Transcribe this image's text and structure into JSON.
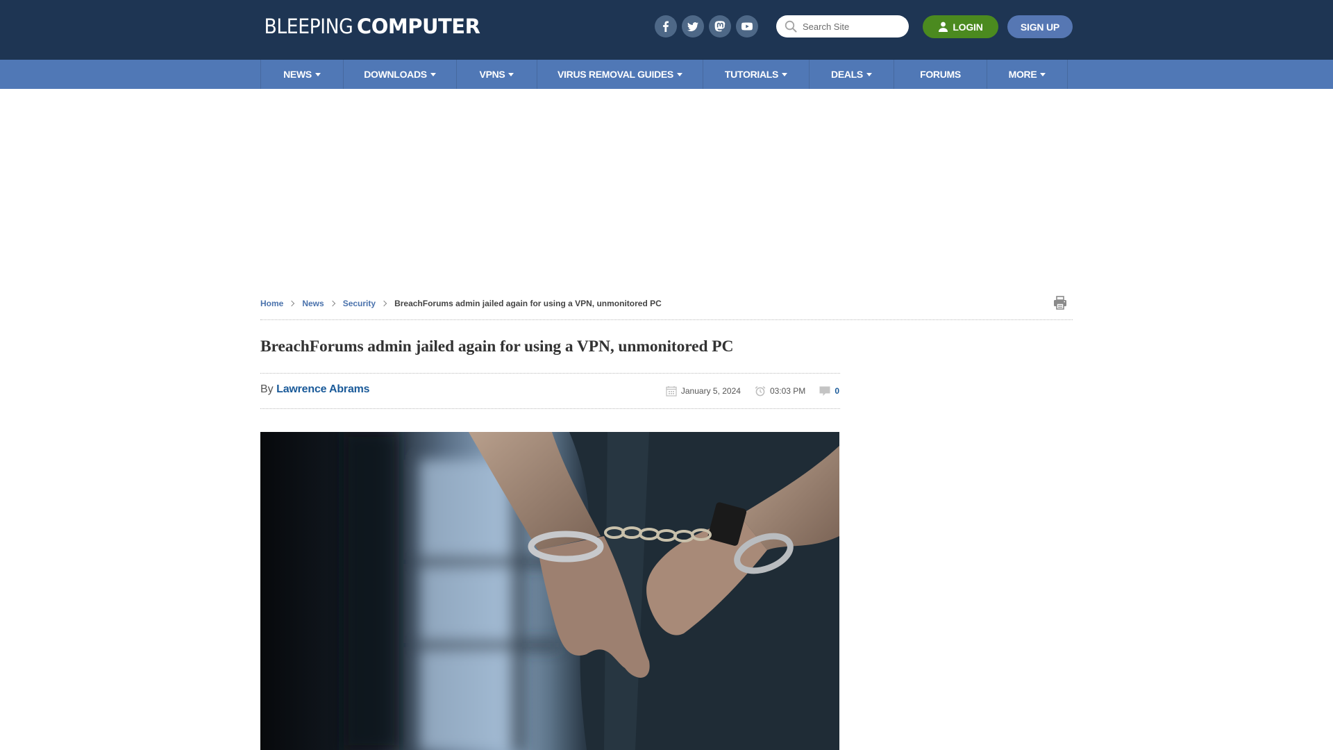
{
  "header": {
    "logo_light": "BLEEPING",
    "logo_bold": "COMPUTER",
    "socials": [
      {
        "name": "facebook",
        "icon": "facebook-icon"
      },
      {
        "name": "twitter",
        "icon": "twitter-icon"
      },
      {
        "name": "mastodon",
        "icon": "mastodon-icon"
      },
      {
        "name": "youtube",
        "icon": "youtube-icon"
      }
    ],
    "search_placeholder": "Search Site",
    "login_label": "LOGIN",
    "signup_label": "SIGN UP",
    "colors": {
      "topbar": "#1e3553",
      "nav": "#5078b6",
      "login": "#4b8a1f",
      "signup": "#5677b3"
    }
  },
  "nav": {
    "items": [
      {
        "label": "NEWS",
        "dropdown": true
      },
      {
        "label": "DOWNLOADS",
        "dropdown": true
      },
      {
        "label": "VPNS",
        "dropdown": true
      },
      {
        "label": "VIRUS REMOVAL GUIDES",
        "dropdown": true
      },
      {
        "label": "TUTORIALS",
        "dropdown": true
      },
      {
        "label": "DEALS",
        "dropdown": true
      },
      {
        "label": "FORUMS",
        "dropdown": false
      },
      {
        "label": "MORE",
        "dropdown": true
      }
    ]
  },
  "breadcrumb": {
    "items": [
      "Home",
      "News",
      "Security"
    ],
    "current": "BreachForums admin jailed again for using a VPN, unmonitored PC"
  },
  "article": {
    "title": "BreachForums admin jailed again for using a VPN, unmonitored PC",
    "by_prefix": "By",
    "author": "Lawrence Abrams",
    "date": "January 5, 2024",
    "time": "03:03 PM",
    "comment_count": "0",
    "hero_image": "handcuffed hands behind back, blurred barred window background"
  }
}
